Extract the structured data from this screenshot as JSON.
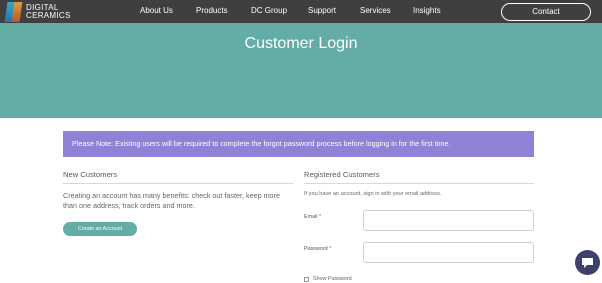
{
  "header": {
    "logo": {
      "line1": "DIGITAL",
      "line2": "CERAMICS"
    },
    "nav": [
      "About Us",
      "Products",
      "DC Group",
      "Support",
      "Services",
      "Insights"
    ],
    "contact_label": "Contact"
  },
  "hero": {
    "title": "Customer Login"
  },
  "notice": {
    "text": "Please Note: Existing users will be required to complete the forgot password process before logging in for the first time."
  },
  "new_customers": {
    "title": "New Customers",
    "benefits": "Creating an account has many benefits: check out faster, keep more than one address, track orders and more.",
    "create_label": "Create an Account"
  },
  "registered_customers": {
    "title": "Registered Customers",
    "intro": "If you have an account, sign in with your email address.",
    "email_label": "Email",
    "password_label": "Password",
    "required_marker": "*",
    "show_password_label": "Show Password"
  },
  "colors": {
    "header_bg": "#3f3f3f",
    "hero_bg": "#64aca6",
    "notice_bg": "#8f81d6",
    "button_bg": "#64aca6",
    "chat_bg": "#3f3f6e"
  },
  "icons": {
    "chat": "chat-bubble-icon",
    "logo": "digital-ceramics-logo"
  }
}
